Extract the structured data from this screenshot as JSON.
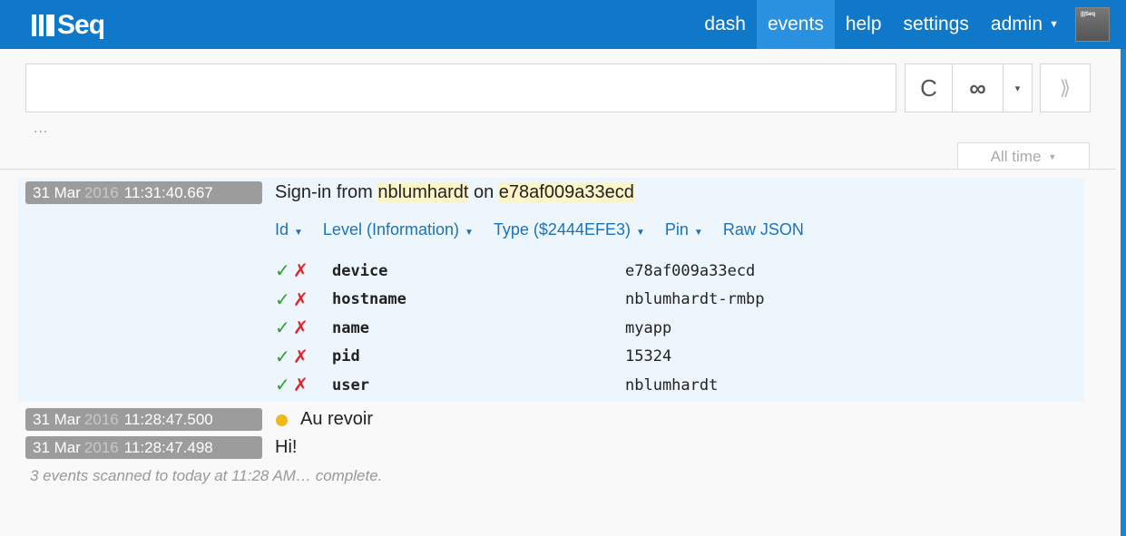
{
  "app": {
    "logo_text": "Seq"
  },
  "nav": {
    "items": [
      {
        "label": "dash",
        "active": false
      },
      {
        "label": "events",
        "active": true
      },
      {
        "label": "help",
        "active": false
      },
      {
        "label": "settings",
        "active": false
      }
    ],
    "user": {
      "label": "admin",
      "avatar_text": "|||Seq"
    }
  },
  "search": {
    "value": "",
    "placeholder": "",
    "below_text": "..."
  },
  "toolbar": {
    "refresh_icon": "refresh-icon",
    "infinite_icon": "infinity-icon",
    "tail_icon": "double-chevron-right-icon",
    "refresh_glyph": "C",
    "infinite_glyph": "∞",
    "drop_glyph": "▾",
    "tail_glyph": "⟫"
  },
  "range": {
    "label": "All time"
  },
  "events": [
    {
      "day": "31 Mar",
      "year": "2016",
      "time": "11:31:40.667",
      "message_parts": [
        {
          "text": "Sign-in from ",
          "highlight": false
        },
        {
          "text": "nblumhardt",
          "highlight": true
        },
        {
          "text": " on ",
          "highlight": false
        },
        {
          "text": "e78af009a33ecd",
          "highlight": true
        }
      ],
      "actions": [
        {
          "label": "Id",
          "caret": true
        },
        {
          "label": "Level (Information)",
          "caret": true
        },
        {
          "label": "Type ($2444EFE3)",
          "caret": true
        },
        {
          "label": "Pin",
          "caret": true
        },
        {
          "label": "Raw JSON",
          "caret": false
        }
      ],
      "properties": [
        {
          "name": "device",
          "value": "e78af009a33ecd"
        },
        {
          "name": "hostname",
          "value": "nblumhardt-rmbp"
        },
        {
          "name": "name",
          "value": "myapp"
        },
        {
          "name": "pid",
          "value": "15324"
        },
        {
          "name": "user",
          "value": "nblumhardt"
        }
      ]
    },
    {
      "day": "31 Mar",
      "year": "2016",
      "time": "11:28:47.500",
      "message": "Au revoir",
      "level_color": "#f0b91a"
    },
    {
      "day": "31 Mar",
      "year": "2016",
      "time": "11:28:47.498",
      "message": "Hi!"
    }
  ],
  "status": "3 events scanned to today at 11:28 AM… complete.",
  "colors": {
    "topbar": "#0f78c8",
    "active_nav": "#2a91e0",
    "link": "#1a73b8",
    "highlight": "#fdf5c7",
    "expanded_bg": "#eef6fd"
  }
}
